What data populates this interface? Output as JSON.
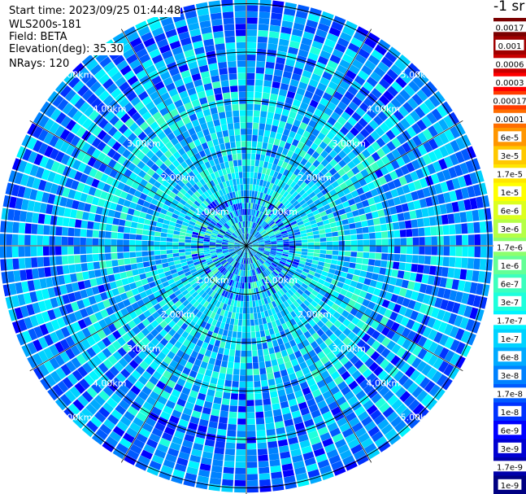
{
  "info": {
    "start_time": "Start time: 2023/09/25 01:44:48",
    "site": "WLS200s-181",
    "field": "Field: BETA",
    "elevation": "Elevation(deg): 35.30",
    "nrays": "NRays: 120"
  },
  "colorbar": {
    "unit": "-1 sr",
    "labels": [
      "0.0017",
      "0.001",
      "0.0006",
      "0.0003",
      "0.00017",
      "0.0001",
      "6e-5",
      "3e-5",
      "1.7e-5",
      "1e-5",
      "6e-6",
      "3e-6",
      "1.7e-6",
      "1e-6",
      "6e-7",
      "3e-7",
      "1.7e-7",
      "1e-7",
      "6e-8",
      "3e-8",
      "1.7e-8",
      "1e-8",
      "6e-9",
      "3e-9",
      "1.7e-9",
      "1e-9"
    ],
    "colors": [
      "#7a0000",
      "#a00000",
      "#c80000",
      "#ff0000",
      "#ff3c00",
      "#ff6e00",
      "#ff9600",
      "#ffc800",
      "#ffe600",
      "#ffff00",
      "#dcff1e",
      "#b4ff46",
      "#8cff6e",
      "#64ff96",
      "#3cffbe",
      "#1effdc",
      "#00f5ff",
      "#00d2ff",
      "#00aaff",
      "#0082ff",
      "#005aff",
      "#0032ff",
      "#0000ff",
      "#0000d2",
      "#0000aa",
      "#000082"
    ],
    "label_bg": "#ffffff",
    "label_bg_dark": "#ffffff"
  },
  "chart_data": {
    "type": "heatmap",
    "projection": "polar",
    "field": "BETA",
    "elevation_deg": 35.3,
    "nrays": 120,
    "range_unit": "km",
    "range_rings": [
      1,
      2,
      3,
      4,
      5
    ],
    "ring_labels": [
      "1.00km",
      "2.00km",
      "3.00km",
      "4.00km",
      "5.00km"
    ],
    "spoke_step_deg": 30,
    "max_range_km": 5.1,
    "value_profile": {
      "description_levels": "near range mixed cyan/blue, mid range cyan, far range blue/cyan",
      "near_level_index": [
        13,
        22
      ],
      "mid_level_index": [
        14,
        19
      ],
      "far_level_index": [
        16,
        22
      ]
    }
  }
}
